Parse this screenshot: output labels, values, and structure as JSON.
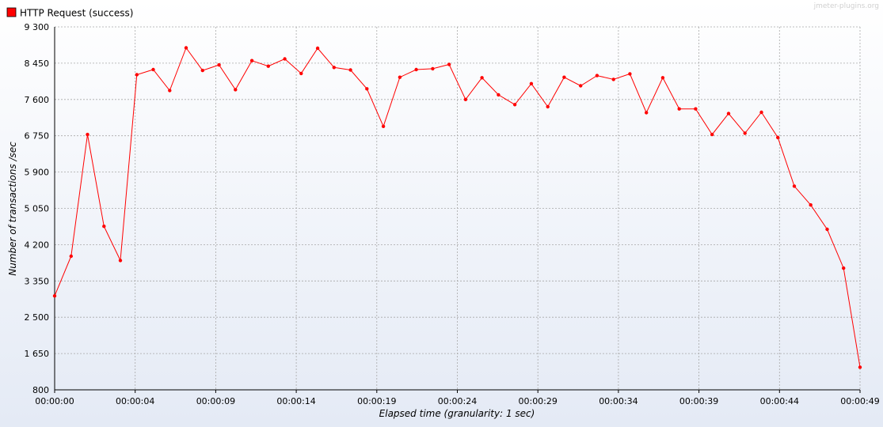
{
  "watermark": "jmeter-plugins.org",
  "colors": {
    "series": "#ff0000",
    "background_top": "#ffffff",
    "background_bottom": "#e4eaf5",
    "grid": "#a8a8a8"
  },
  "chart_data": {
    "type": "line",
    "xlabel": "Elapsed time (granularity: 1 sec)",
    "ylabel": "Number of transactions /sec",
    "legend_position": "top-left",
    "grid": true,
    "ylim": [
      800,
      9300
    ],
    "xlim": [
      0,
      49
    ],
    "y_ticks": [
      "800",
      "1 650",
      "2 500",
      "3 350",
      "4 200",
      "5 050",
      "5 900",
      "6 750",
      "7 600",
      "8 450",
      "9 300"
    ],
    "y_tick_values": [
      800,
      1650,
      2500,
      3350,
      4200,
      5050,
      5900,
      6750,
      7600,
      8450,
      9300
    ],
    "x_ticks": [
      "00:00:00",
      "00:00:04",
      "00:00:09",
      "00:00:14",
      "00:00:19",
      "00:00:24",
      "00:00:29",
      "00:00:34",
      "00:00:39",
      "00:00:44",
      "00:00:49"
    ],
    "x_tick_values": [
      0,
      4.9,
      9.8,
      14.7,
      19.6,
      24.5,
      29.4,
      34.3,
      39.2,
      44.1,
      49
    ],
    "series": [
      {
        "name": "HTTP Request (success)",
        "x": [
          0,
          1,
          2,
          3,
          4,
          5,
          6,
          7,
          8,
          9,
          10,
          11,
          12,
          13,
          14,
          15,
          16,
          17,
          18,
          19,
          20,
          21,
          22,
          23,
          24,
          25,
          26,
          27,
          28,
          29,
          30,
          31,
          32,
          33,
          34,
          35,
          36,
          37,
          38,
          39,
          40,
          41,
          42,
          43,
          44,
          45,
          46,
          47,
          48,
          49
        ],
        "values": [
          3000,
          3930,
          6780,
          4630,
          3830,
          8180,
          8300,
          7810,
          8810,
          8280,
          8410,
          7830,
          8510,
          8380,
          8550,
          8210,
          8800,
          8350,
          8290,
          7850,
          6970,
          8120,
          8300,
          8320,
          8420,
          7600,
          8110,
          7710,
          7480,
          7970,
          7430,
          8120,
          7920,
          8160,
          8070,
          8200,
          7290,
          8110,
          7380,
          7380,
          6780,
          7270,
          6810,
          7300,
          6710,
          5570,
          5130,
          4560,
          3650,
          1330
        ]
      }
    ]
  }
}
